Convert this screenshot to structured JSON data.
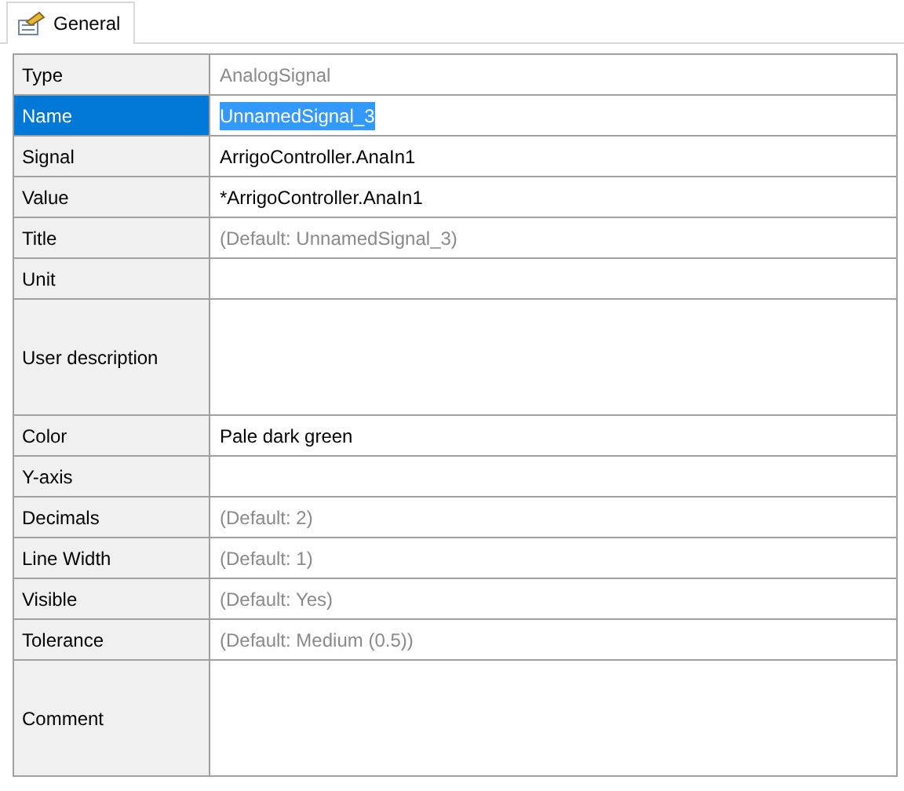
{
  "tabs": [
    {
      "label": "General",
      "selected": true
    }
  ],
  "properties": [
    {
      "label": "Type",
      "value": "AnalogSignal",
      "kind": "single",
      "dimmed": true,
      "selected": false
    },
    {
      "label": "Name",
      "value": "UnnamedSignal_3",
      "kind": "single",
      "dimmed": false,
      "selected": true
    },
    {
      "label": "Signal",
      "value": "ArrigoController.AnaIn1",
      "kind": "single",
      "dimmed": false,
      "selected": false
    },
    {
      "label": "Value",
      "value": "*ArrigoController.AnaIn1",
      "kind": "single",
      "dimmed": false,
      "selected": false
    },
    {
      "label": "Title",
      "value": "(Default: UnnamedSignal_3)",
      "kind": "single",
      "dimmed": true,
      "selected": false
    },
    {
      "label": "Unit",
      "kind": "single",
      "selected": false
    },
    {
      "label": "User description",
      "kind": "multiline",
      "selected": false
    },
    {
      "label": "Color",
      "value": "Pale dark green",
      "kind": "single",
      "dimmed": false,
      "selected": false
    },
    {
      "label": "Y-axis",
      "kind": "single",
      "selected": false
    },
    {
      "label": "Decimals",
      "value": "(Default: 2)",
      "kind": "single",
      "dimmed": true,
      "selected": false
    },
    {
      "label": "Line Width",
      "value": "(Default: 1)",
      "kind": "single",
      "dimmed": true,
      "selected": false
    },
    {
      "label": "Visible",
      "value": "(Default: Yes)",
      "kind": "single",
      "dimmed": true,
      "selected": false
    },
    {
      "label": "Tolerance",
      "value": "(Default: Medium (0.5))",
      "kind": "single",
      "dimmed": true,
      "selected": false
    },
    {
      "label": "Comment",
      "kind": "multiline",
      "selected": false
    }
  ]
}
